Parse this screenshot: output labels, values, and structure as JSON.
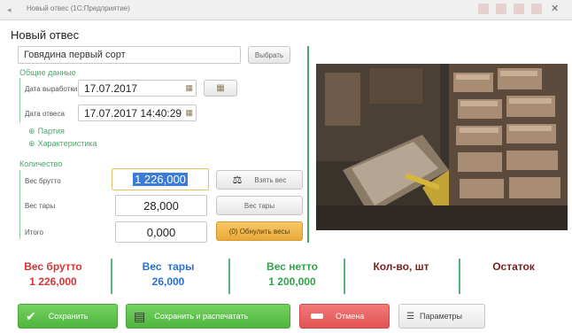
{
  "window": {
    "title": "Новый отвес (1С:Предприятие)"
  },
  "page_title": "Новый отвес",
  "product": {
    "value": "Говядина первый сорт",
    "choose_label": "Выбрать"
  },
  "general": {
    "header": "Общие данные",
    "production_date_label": "Дата выработки",
    "production_date": "17.07.2017",
    "weigh_date_label": "Дата отвеса",
    "weigh_date": "17.07.2017 14:40:29",
    "links": [
      "Партия",
      "Характеристика"
    ]
  },
  "quantity": {
    "header": "Количество",
    "gross_label": "Вес брутто",
    "gross_value": "1 226,000",
    "gross_button": "Взять вес",
    "tare_label": "Вес тары",
    "tare_value": "28,000",
    "tare_button": "Вес тары",
    "total_label": "Итого",
    "total_value": "0,000",
    "reset_button": "(0) Обнулить весы"
  },
  "summary": [
    {
      "label": "Вес брутто",
      "value": "1 226,000",
      "color": "#d83333"
    },
    {
      "label": "Вес  тары",
      "value": "26,000",
      "color": "#2b6fd3"
    },
    {
      "label": "Вес нетто",
      "value": "1 200,000",
      "color": "#2fa34a"
    },
    {
      "label": "Кол-во, шт",
      "value": "",
      "color": "#7a1f1f"
    },
    {
      "label": "Остаток",
      "value": "",
      "color": "#7a1f1f"
    }
  ],
  "buttons": {
    "save": "Сохранить",
    "save_print": "Сохранить и распечатать",
    "cancel": "Отмена",
    "params": "Параметры"
  },
  "colors": {
    "accent": "#4aa56b",
    "save": "#5cc24a",
    "cancel": "#e85c5c",
    "reset": "#f0b446"
  }
}
